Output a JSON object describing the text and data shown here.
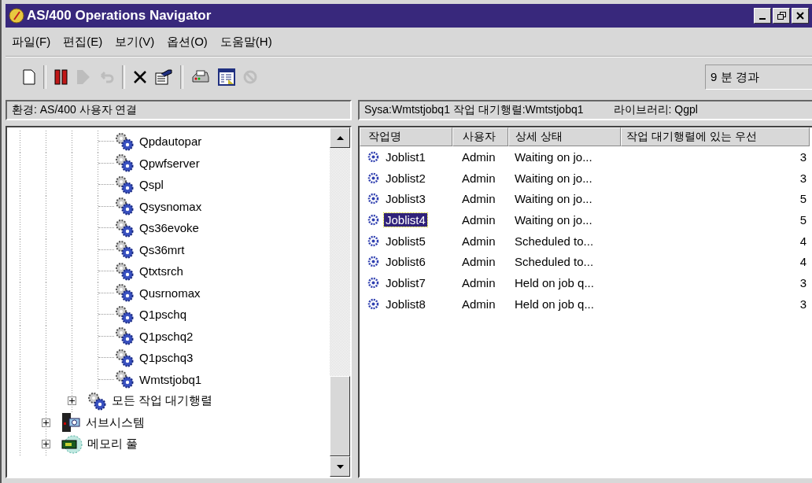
{
  "window": {
    "title": "AS/400 Operations Navigator"
  },
  "menu": [
    "파일(F)",
    "편집(E)",
    "보기(V)",
    "옵션(O)",
    "도움말(H)"
  ],
  "toolbar": [
    {
      "kind": "new",
      "disabled": false
    },
    {
      "kind": "sep"
    },
    {
      "kind": "hold",
      "disabled": false
    },
    {
      "kind": "release",
      "disabled": true
    },
    {
      "kind": "reply",
      "disabled": true
    },
    {
      "kind": "sep"
    },
    {
      "kind": "delete",
      "disabled": false
    },
    {
      "kind": "properties",
      "disabled": false
    },
    {
      "kind": "sep"
    },
    {
      "kind": "print",
      "disabled": false
    },
    {
      "kind": "joblist",
      "disabled": false
    },
    {
      "kind": "stop",
      "disabled": true
    }
  ],
  "elapsed": "9 분 경과",
  "left_header": "환경: AS/400 사용자 연결",
  "right_header": {
    "path": "Sysa:Wmtstjobq1 작업 대기행렬:Wmtstjobq1",
    "library": "라이브러리: Qgpl"
  },
  "tree": [
    {
      "children": [
        {
          "children": [
            {
              "label": "Qpdautopar",
              "kind": "queue"
            },
            {
              "label": "Qpwfserver",
              "kind": "queue"
            },
            {
              "label": "Qspl",
              "kind": "queue"
            },
            {
              "label": "Qsysnomax",
              "kind": "queue"
            },
            {
              "label": "Qs36evoke",
              "kind": "queue"
            },
            {
              "label": "Qs36mrt",
              "kind": "queue"
            },
            {
              "label": "Qtxtsrch",
              "kind": "queue"
            },
            {
              "label": "Qusrnomax",
              "kind": "queue"
            },
            {
              "label": "Q1pschq",
              "kind": "queue"
            },
            {
              "label": "Q1pschq2",
              "kind": "queue"
            },
            {
              "label": "Q1pschq3",
              "kind": "queue"
            },
            {
              "label": "Wmtstjobq1",
              "kind": "queue"
            }
          ]
        },
        {
          "label": "모든 작업 대기행렬",
          "kind": "queue",
          "expanded": false
        }
      ]
    },
    {
      "label": "서브시스템",
      "kind": "subsystem",
      "expanded": false
    },
    {
      "label": "메모리 풀",
      "kind": "memory",
      "expanded": false
    }
  ],
  "table": {
    "columns": [
      "작업명",
      "사용자",
      "상세 상태",
      "작업 대기행렬에 있는 우선"
    ],
    "rows": [
      {
        "name": "Joblist1",
        "user": "Admin",
        "status": "Waiting on jo...",
        "priority": "3",
        "selected": false
      },
      {
        "name": "Joblist2",
        "user": "Admin",
        "status": "Waiting on jo...",
        "priority": "3",
        "selected": false
      },
      {
        "name": "Joblist3",
        "user": "Admin",
        "status": "Waiting on jo...",
        "priority": "5",
        "selected": false
      },
      {
        "name": "Joblist4",
        "user": "Admin",
        "status": "Waiting on jo...",
        "priority": "5",
        "selected": true
      },
      {
        "name": "Joblist5",
        "user": "Admin",
        "status": "Scheduled to...",
        "priority": "4",
        "selected": false
      },
      {
        "name": "Joblist6",
        "user": "Admin",
        "status": "Scheduled to...",
        "priority": "4",
        "selected": false
      },
      {
        "name": "Joblist7",
        "user": "Admin",
        "status": "Held on job q...",
        "priority": "3",
        "selected": false
      },
      {
        "name": "Joblist8",
        "user": "Admin",
        "status": "Held on job q...",
        "priority": "3",
        "selected": false
      }
    ]
  }
}
